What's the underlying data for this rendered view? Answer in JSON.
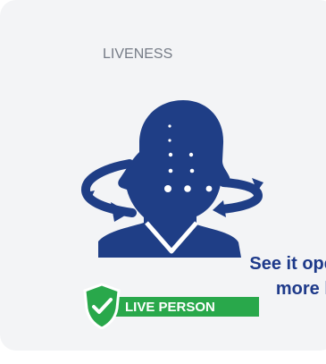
{
  "card": {
    "title": "LIVENESS",
    "badge_label": "LIVE PERSON",
    "overflow_text": "See it operate more lo"
  },
  "icons": {
    "illustration": "face-rotation-icon",
    "badge": "shield-check-icon"
  },
  "colors": {
    "card_background": "#f3f4f6",
    "title_text": "#757b86",
    "illustration_blue": "#1f3e86",
    "badge_green": "#29a84b",
    "overflow_text": "#1e3a8a"
  }
}
